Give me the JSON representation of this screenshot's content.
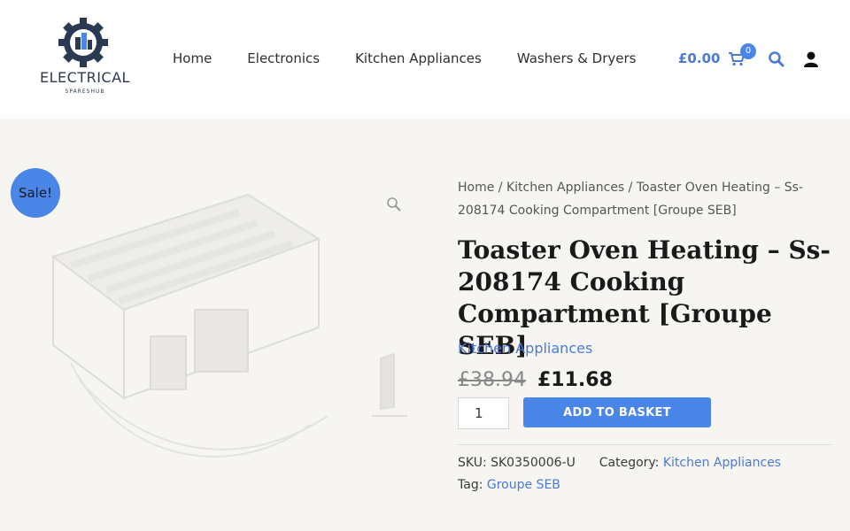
{
  "brand": {
    "name": "ELECTRICAL",
    "tagline": "SPARESHUB",
    "logo_icon": "gear-building-logo"
  },
  "nav": {
    "items": [
      {
        "label": "Home"
      },
      {
        "label": "Electronics"
      },
      {
        "label": "Kitchen Appliances"
      },
      {
        "label": "Washers & Dryers"
      }
    ]
  },
  "cart": {
    "total": "£0.00",
    "count": "0",
    "icon": "basket-icon"
  },
  "header_icons": {
    "search": "search-icon",
    "account": "user-icon"
  },
  "product": {
    "sale_badge": "Sale!",
    "breadcrumb": {
      "home": "Home",
      "sep": " / ",
      "category": "Kitchen Appliances",
      "current": "Toaster Oven Heating – Ss-208174 Cooking Compartment [Groupe SEB]"
    },
    "title": "Toaster Oven Heating – Ss-208174 Cooking Compartment [Groupe SEB]",
    "category": "Kitchen Appliances",
    "old_price": "£38.94",
    "price": "£11.68",
    "quantity": "1",
    "add_to_basket": "ADD TO BASKET",
    "sku_label": "SKU:",
    "sku": "SK0350006-U",
    "category_label": "Category:",
    "category_value": "Kitchen Appliances",
    "tag_label": "Tag:",
    "tag_value": "Groupe SEB",
    "zoom_icon": "magnifier-icon"
  },
  "colors": {
    "accent": "#4a86e8",
    "link": "#4a7ad8",
    "background": "#f6f5f2"
  }
}
